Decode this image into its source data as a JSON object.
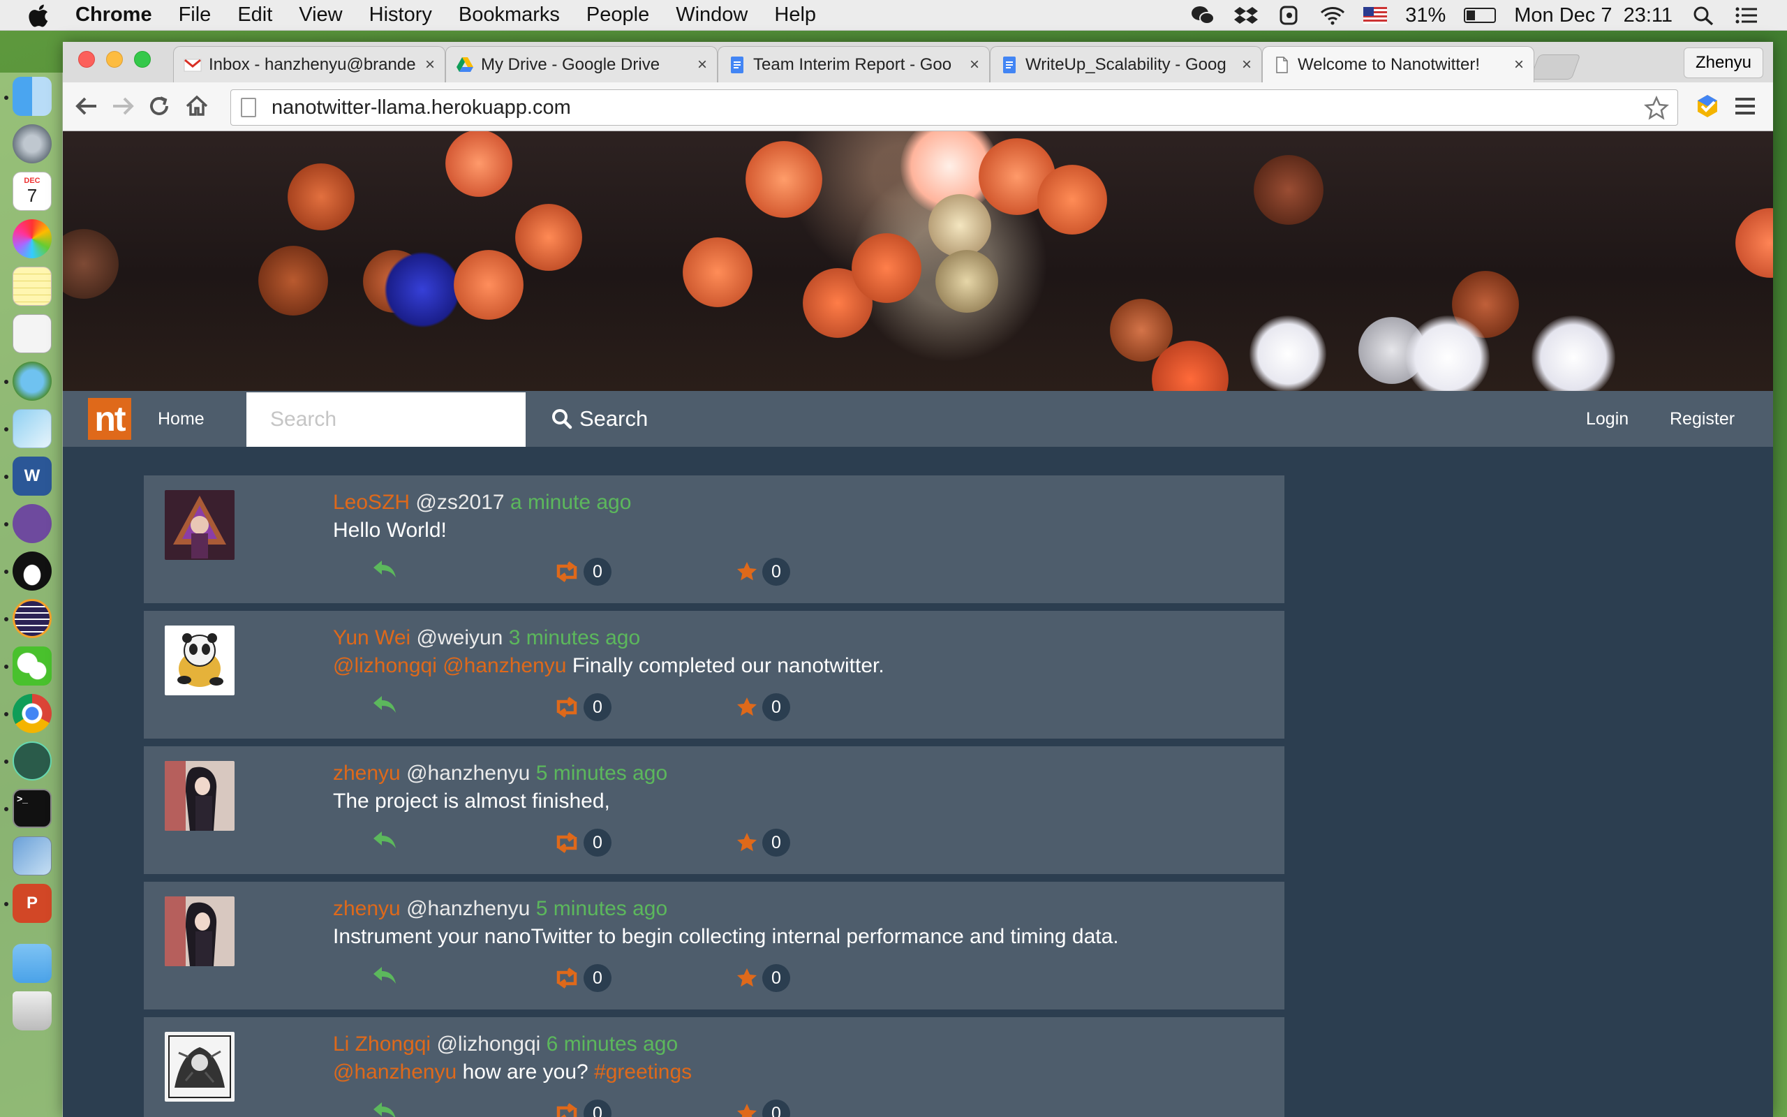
{
  "menubar": {
    "app_name": "Chrome",
    "menus": [
      "File",
      "Edit",
      "View",
      "History",
      "Bookmarks",
      "People",
      "Window",
      "Help"
    ],
    "battery": "31%",
    "battery_level": 0.31,
    "clock": "Mon Dec 7  23:11"
  },
  "dock": {
    "items": [
      "finder-icon",
      "launchpad-icon",
      "calendar-icon",
      "photos-icon",
      "notes-icon",
      "textedit-icon",
      "maps-icon",
      "preview-icon",
      "word-icon",
      "github-icon",
      "qq-icon",
      "eclipse-icon",
      "wechat-icon",
      "chrome-icon",
      "atom-icon",
      "terminal-icon",
      "image-capture-icon",
      "powerpoint-icon",
      "folder-icon",
      "trash-icon"
    ],
    "calendar": {
      "month": "DEC",
      "day": "7"
    }
  },
  "browser": {
    "tabs": [
      {
        "title": "Inbox - hanzhenyu@brande",
        "icon": "gmail-icon"
      },
      {
        "title": "My Drive - Google Drive",
        "icon": "google-drive-icon"
      },
      {
        "title": "Team Interim Report - Goo",
        "icon": "google-docs-icon"
      },
      {
        "title": "WriteUp_Scalability - Goog",
        "icon": "google-docs-icon"
      },
      {
        "title": "Welcome to Nanotwitter!",
        "icon": "page-icon",
        "active": true
      }
    ],
    "close_glyph": "×",
    "profile_name": "Zhenyu",
    "url": "nanotwitter-llama.herokuapp.com"
  },
  "site": {
    "logo": "nt",
    "nav_home": "Home",
    "search_placeholder": "Search",
    "search_button": "Search",
    "login": "Login",
    "register": "Register",
    "brand_color": "#df691a",
    "accent_green": "#5cb85c"
  },
  "tweets": [
    {
      "name": "LeoSZH",
      "handle": "@zs2017",
      "time": "a minute ago",
      "mentions": [],
      "text": "Hello World!",
      "hashtag": "",
      "retweets": "0",
      "favorites": "0",
      "avatar": "avatar-purple-warrior"
    },
    {
      "name": "Yun Wei",
      "handle": "@weiyun",
      "time": "3 minutes ago",
      "mentions": [
        "@lizhongqi",
        "@hanzhenyu"
      ],
      "text": "Finally completed our nanotwitter.",
      "hashtag": "",
      "retweets": "0",
      "favorites": "0",
      "avatar": "avatar-panda"
    },
    {
      "name": "zhenyu",
      "handle": "@hanzhenyu",
      "time": "5 minutes ago",
      "mentions": [],
      "text": "The project is almost finished,",
      "hashtag": "",
      "retweets": "0",
      "favorites": "0",
      "avatar": "avatar-anime"
    },
    {
      "name": "zhenyu",
      "handle": "@hanzhenyu",
      "time": "5 minutes ago",
      "mentions": [],
      "text": "Instrument your nanoTwitter to begin collecting internal performance and timing data.",
      "hashtag": "",
      "retweets": "0",
      "favorites": "0",
      "avatar": "avatar-anime"
    },
    {
      "name": "Li Zhongqi",
      "handle": "@lizhongqi",
      "time": "6 minutes ago",
      "mentions": [
        "@hanzhenyu"
      ],
      "text": "how are you?",
      "hashtag": "#greetings",
      "retweets": "0",
      "favorites": "0",
      "avatar": "avatar-sketch"
    }
  ]
}
